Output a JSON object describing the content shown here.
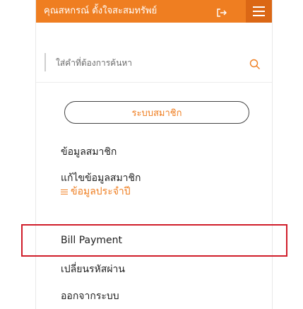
{
  "header": {
    "title": "คุณสหกรณ์ ตั้งใจสะสมทรัพย์"
  },
  "search": {
    "placeholder": "ใส่คำที่ต้องการค้นหา"
  },
  "member_system": {
    "label": "ระบบสมาชิก"
  },
  "menu": {
    "items": [
      {
        "label": "ข้อมูลสมาชิก"
      },
      {
        "label": "แก้ไขข้อมูลสมาชิก"
      },
      {
        "label": "ข้อมูลประจำปี"
      },
      {
        "label": "Bill Payment"
      },
      {
        "label": "เปลี่ยนรหัสผ่าน"
      },
      {
        "label": "ออกจากระบบ"
      }
    ]
  },
  "colors": {
    "brand_orange": "#ef7e21",
    "menu_button_dark_orange": "#db6715",
    "highlight_red": "#d01d2a"
  },
  "icons": {
    "logout": "logout-icon",
    "menu": "hamburger-icon",
    "search": "search-icon"
  }
}
